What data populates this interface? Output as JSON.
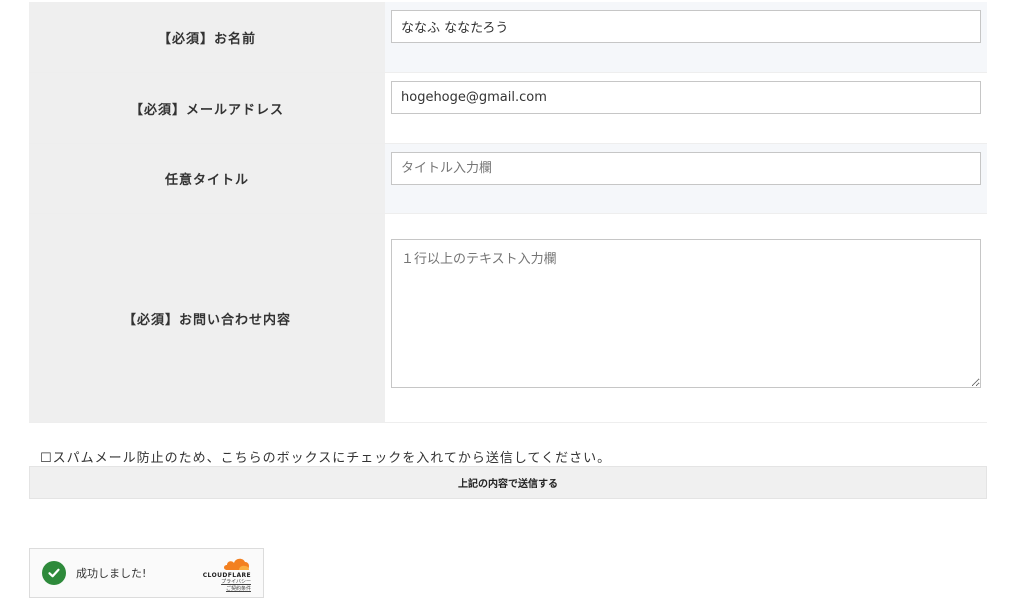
{
  "form": {
    "fields": [
      {
        "label": "【必須】お名前",
        "value": "ななふ ななたろう",
        "placeholder": ""
      },
      {
        "label": "【必須】メールアドレス",
        "value": "hogehoge@gmail.com",
        "placeholder": ""
      },
      {
        "label": "任意タイトル",
        "value": "",
        "placeholder": "タイトル入力欄"
      },
      {
        "label": "【必須】お問い合わせ内容",
        "value": "",
        "placeholder": "１行以上のテキスト入力欄"
      }
    ],
    "spam_note": "☐スパムメール防止のため、こちらのボックスにチェックを入れてから送信してください。",
    "submit_label": "上記の内容で送信する"
  },
  "captcha": {
    "status_text": "成功しました!",
    "brand": "CLOUDFLARE",
    "privacy_link": "プライバシー",
    "terms_link": "ご契約条件",
    "check_color": "#2e8a3b",
    "brand_color": "#f38020"
  }
}
